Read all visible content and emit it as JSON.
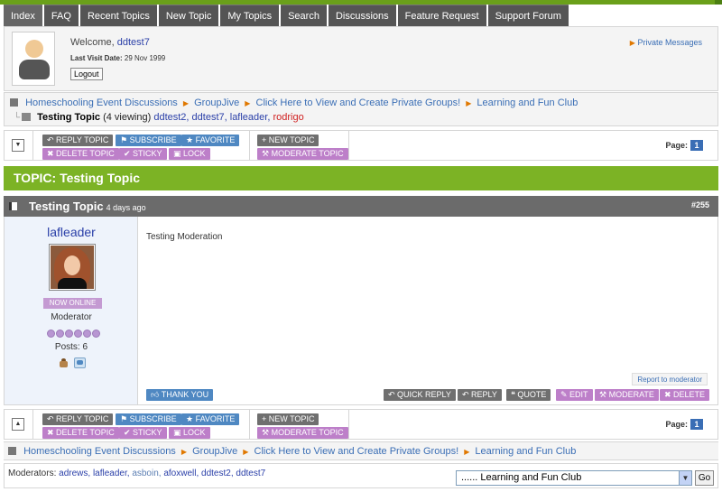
{
  "nav": {
    "tabs": [
      "Index",
      "FAQ",
      "Recent Topics",
      "New Topic",
      "My Topics",
      "Search",
      "Discussions",
      "Feature Request",
      "Support Forum"
    ]
  },
  "welcome": {
    "greeting": "Welcome, ",
    "username": "ddtest7",
    "last_visit_label": "Last Visit Date:",
    "last_visit_value": "29 Nov 1999",
    "logout_label": "Logout",
    "private_messages": "Private Messages"
  },
  "breadcrumb": {
    "items": [
      "Homeschooling Event Discussions",
      "GroupJive",
      "Click Here to View and Create Private Groups!",
      "Learning and Fun Club"
    ]
  },
  "viewing": {
    "topic": "Testing Topic",
    "count": "(4 viewing)",
    "users": [
      "ddtest2,",
      "ddtest7,",
      "lafleader,",
      "rodrigo"
    ]
  },
  "toolbar": {
    "reply_topic": "REPLY TOPIC",
    "subscribe": "SUBSCRIBE",
    "favorite": "FAVORITE",
    "new_topic": "NEW TOPIC",
    "delete_topic": "DELETE TOPIC",
    "sticky": "STICKY",
    "lock": "LOCK",
    "moderate_topic": "MODERATE TOPIC",
    "page_label": "Page:",
    "page_number": "1"
  },
  "topic": {
    "header": "TOPIC: Testing Topic"
  },
  "post": {
    "title": "Testing Topic",
    "ago": "4 days ago",
    "number": "#255",
    "author": "lafleader",
    "online_status": "NOW ONLINE",
    "role": "Moderator",
    "posts": "Posts: 6",
    "rank_dots": 6,
    "text": "Testing Moderation",
    "report": "Report to moderator",
    "thank_you": "THANK YOU",
    "quick_reply": "QUICK REPLY",
    "reply": "REPLY",
    "quote": "QUOTE",
    "edit": "EDIT",
    "moderate": "MODERATE",
    "delete": "DELETE"
  },
  "footer": {
    "moderators_label": "Moderators:",
    "moderators": [
      "adrews,",
      "lafleader,",
      "asboin,",
      "afoxwell,",
      "ddtest2,",
      "ddtest7"
    ],
    "jump_select": "...... Learning and Fun Club",
    "go": "Go"
  },
  "colors": {
    "accent_green": "#7cb325",
    "tab_gray": "#555555",
    "link_blue": "#2a3fa8",
    "button_blue": "#4f88c2",
    "button_purple": "#bd7fc9"
  }
}
